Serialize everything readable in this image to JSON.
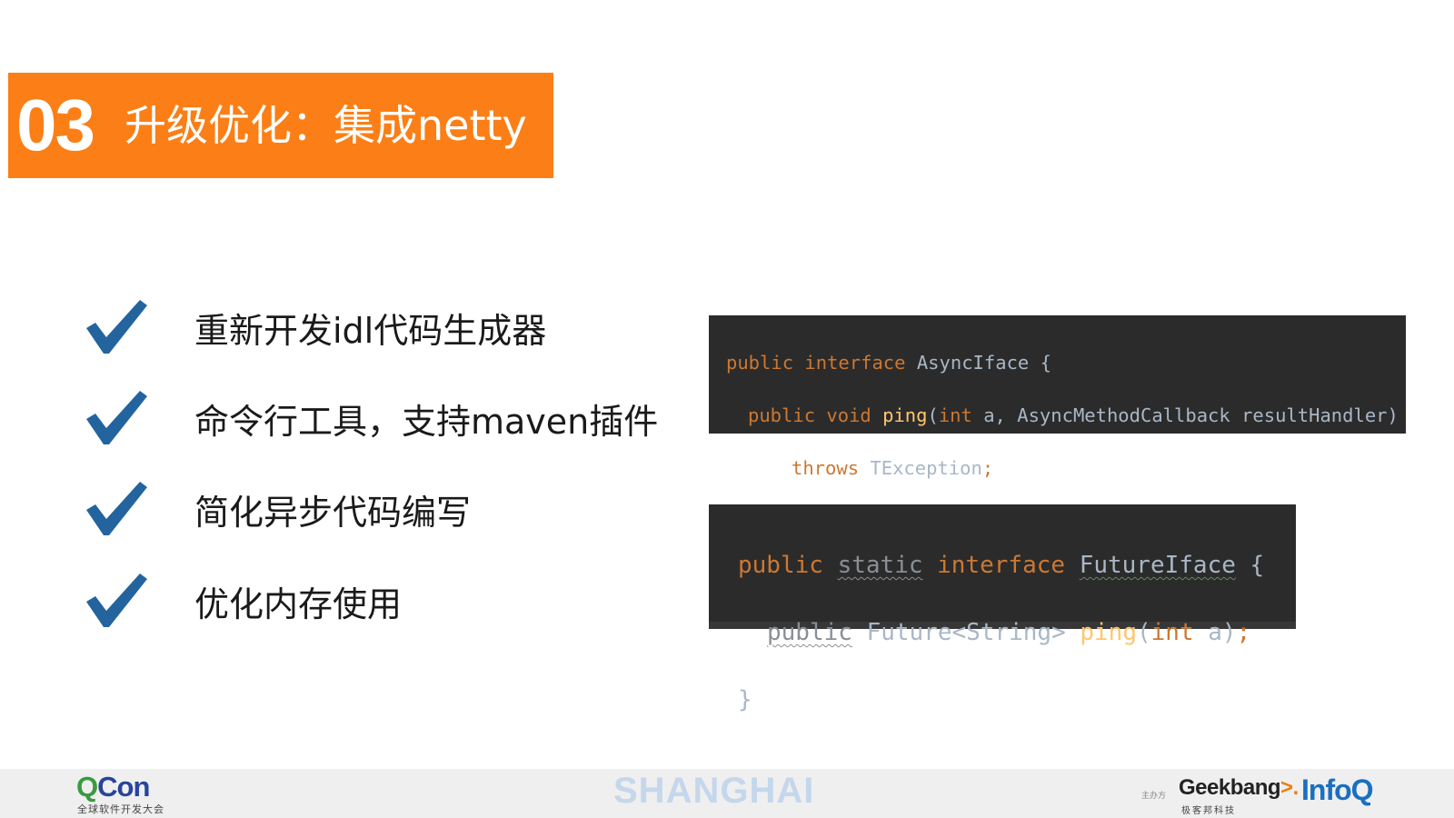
{
  "title": {
    "number": "03",
    "text": "升级优化：集成netty",
    "background_color": "#fb7f16"
  },
  "bullets": {
    "icon": "check-icon",
    "icon_color": "#23649e",
    "items": [
      {
        "label": "重新开发idl代码生成器"
      },
      {
        "label": "命令行工具，支持maven插件"
      },
      {
        "label": "简化异步代码编写"
      },
      {
        "label": "优化内存使用"
      }
    ]
  },
  "code_async": {
    "background_color": "#2b2b2b",
    "line1": {
      "kw": "public interface ",
      "name": "AsyncIface {"
    },
    "line2": {
      "kw": "public void ",
      "fn": "ping",
      "open": "(",
      "type": "int ",
      "args": "a, AsyncMethodCallback resultHandler)"
    },
    "line3": {
      "kw": "throws ",
      "rest": "TException",
      "semi": ";"
    },
    "line4": "}"
  },
  "code_future": {
    "background_color": "#2b2b2b",
    "line1": {
      "kw1": "public ",
      "kw2": "static",
      "kw3": " interface ",
      "name": "FutureIface",
      "brace": " {"
    },
    "line2": {
      "kw": "public",
      "type": " Future<String> ",
      "fn": "ping",
      "open": "(",
      "argtype": "int ",
      "args": "a)",
      "semi": ";"
    },
    "line3": "}"
  },
  "footer": {
    "qcon_q": "Q",
    "qcon_rest": "Con",
    "qcon_sub": "全球软件开发大会",
    "city": "SHANGHAI",
    "organizer_label": "主办方",
    "geek": "Geekbang",
    "geek_arrow": ">.",
    "geek_sub": "极客邦科技",
    "infoq": "InfoQ"
  }
}
